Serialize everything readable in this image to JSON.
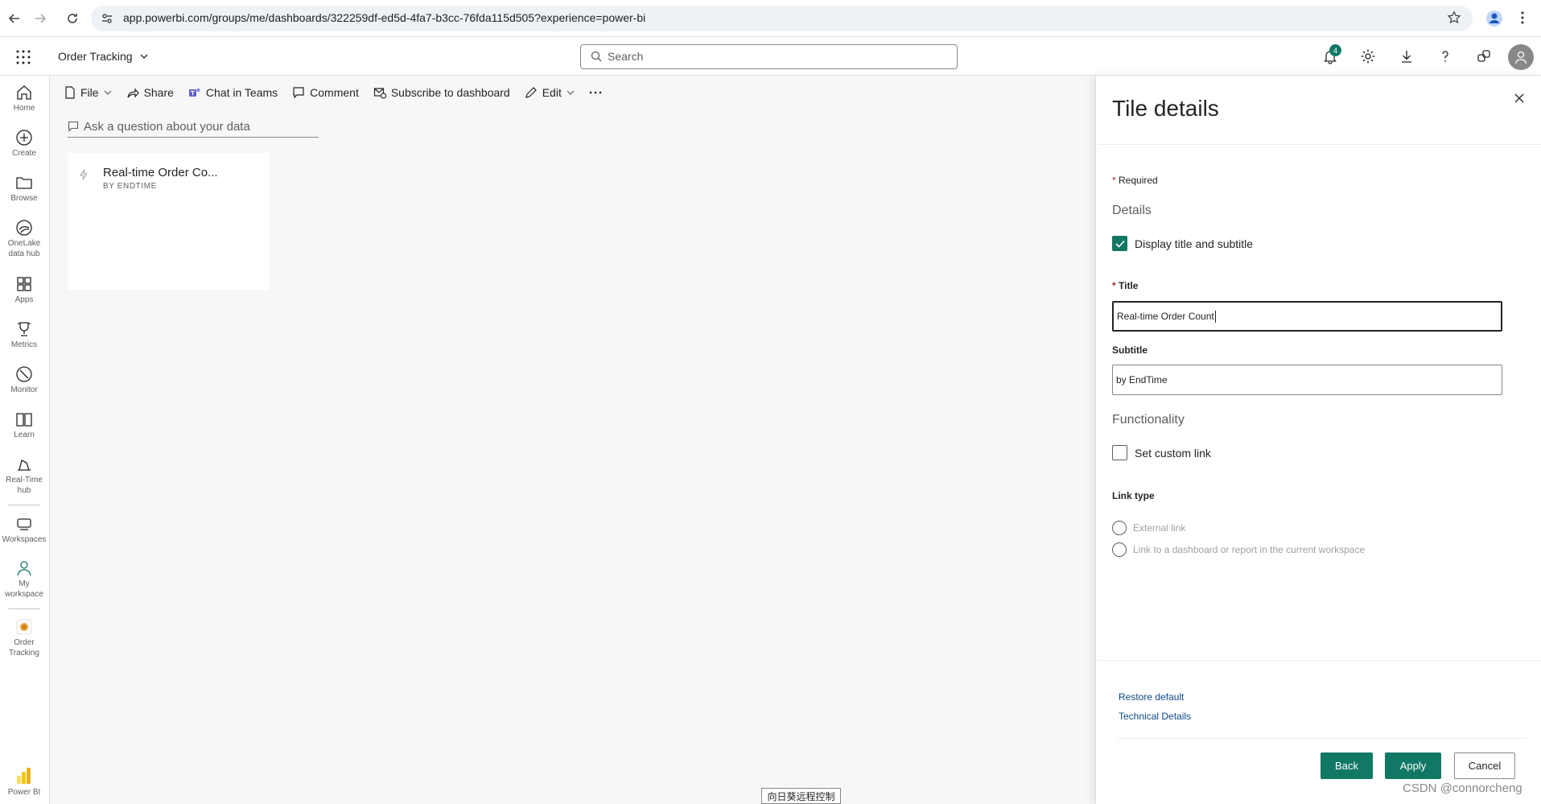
{
  "browser": {
    "url": "app.powerbi.com/groups/me/dashboards/322259df-ed5d-4fa7-b3cc-76fda115d505?experience=power-bi"
  },
  "header": {
    "workspace_name": "Order Tracking",
    "search_placeholder": "Search",
    "notification_count": "4"
  },
  "rail": {
    "items": [
      {
        "label": "Home",
        "icon": "home-icon"
      },
      {
        "label": "Create",
        "icon": "create-icon"
      },
      {
        "label": "Browse",
        "icon": "browse-icon"
      },
      {
        "label": "OneLake\ndata hub",
        "icon": "onelake-icon"
      },
      {
        "label": "Apps",
        "icon": "apps-icon"
      },
      {
        "label": "Metrics",
        "icon": "metrics-icon"
      },
      {
        "label": "Monitor",
        "icon": "monitor-icon"
      },
      {
        "label": "Learn",
        "icon": "learn-icon"
      },
      {
        "label": "Real-Time\nhub",
        "icon": "realtime-icon"
      },
      {
        "label": "Workspaces",
        "icon": "workspaces-icon"
      },
      {
        "label": "My\nworkspace",
        "icon": "my-workspace-icon"
      },
      {
        "label": "Order\nTracking",
        "icon": "order-tracking-icon"
      }
    ],
    "footer_label": "Power BI"
  },
  "toolbar": {
    "file": "File",
    "share": "Share",
    "teams": "Chat in Teams",
    "comment": "Comment",
    "subscribe": "Subscribe to dashboard",
    "edit": "Edit"
  },
  "qna": {
    "placeholder": "Ask a question about your data"
  },
  "tile": {
    "title": "Real-time Order Co...",
    "subtitle": "BY ENDTIME"
  },
  "pane": {
    "title": "Tile details",
    "required_note": "Required",
    "details_heading": "Details",
    "display_checkbox_label": "Display title and subtitle",
    "display_checked": true,
    "title_label": "Title",
    "title_value": "Real-time Order Count",
    "subtitle_label": "Subtitle",
    "subtitle_value": "by EndTime",
    "functionality_heading": "Functionality",
    "custom_link_label": "Set custom link",
    "custom_link_checked": false,
    "link_type_label": "Link type",
    "radio_external": "External link",
    "radio_internal": "Link to a dashboard or report in the current workspace",
    "restore_default": "Restore default",
    "technical_details": "Technical Details",
    "back_button": "Back",
    "apply_button": "Apply",
    "cancel_button": "Cancel"
  },
  "overlay": {
    "remote_tip": "向日葵远程控制",
    "watermark": "CSDN @connorcheng"
  },
  "colors": {
    "primary": "#117865",
    "link": "#0f4a85",
    "badge": "#117865"
  }
}
